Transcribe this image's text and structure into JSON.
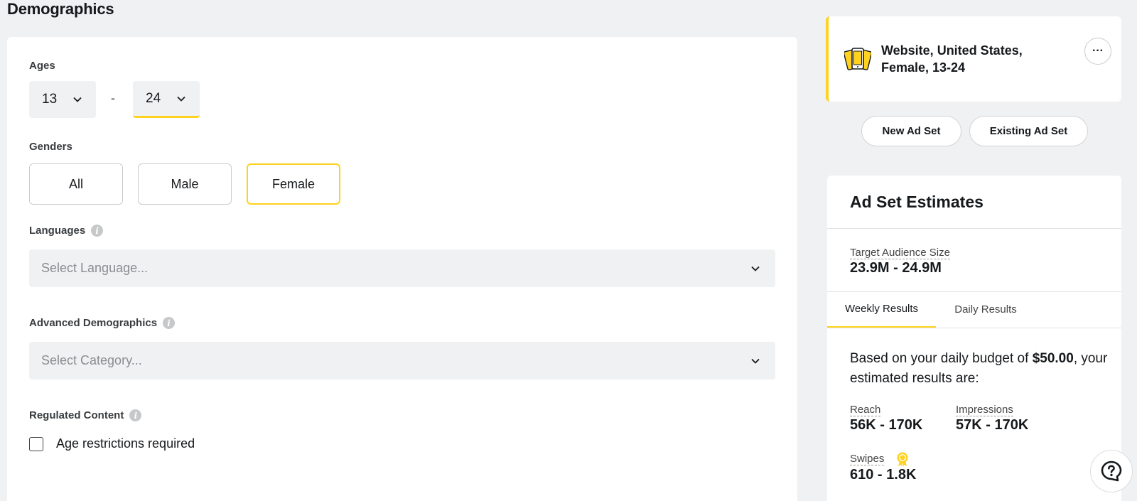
{
  "section_title": "Demographics",
  "ages": {
    "label": "Ages",
    "min": "13",
    "separator": "-",
    "max": "24"
  },
  "genders": {
    "label": "Genders",
    "options": [
      "All",
      "Male",
      "Female"
    ],
    "selected": "Female"
  },
  "languages": {
    "label": "Languages",
    "placeholder": "Select Language..."
  },
  "advanced_demographics": {
    "label": "Advanced Demographics",
    "placeholder": "Select Category..."
  },
  "regulated_content": {
    "label": "Regulated Content",
    "checkbox_label": "Age restrictions required",
    "checked": false
  },
  "audience_card": {
    "line1": "Website, United States,",
    "line2": "Female, 13-24",
    "more": "···"
  },
  "ad_set_buttons": {
    "new": "New Ad Set",
    "existing": "Existing Ad Set"
  },
  "estimates": {
    "title": "Ad Set Estimates",
    "target_label": "Target Audience Size",
    "target_value": "23.9M - 24.9M",
    "tabs": [
      "Weekly Results",
      "Daily Results"
    ],
    "active_tab": "Weekly Results",
    "budget_prefix": "Based on your daily budget of ",
    "budget_amount": "$50.00",
    "budget_suffix": ", your estimated results are:",
    "reach_label": "Reach",
    "reach_value": "56K - 170K",
    "impressions_label": "Impressions",
    "impressions_value": "57K - 170K",
    "swipes_label": "Swipes",
    "swipes_value": "610 - 1.8K"
  },
  "colors": {
    "accent": "#ffd21f",
    "background": "#f0f1f2"
  }
}
